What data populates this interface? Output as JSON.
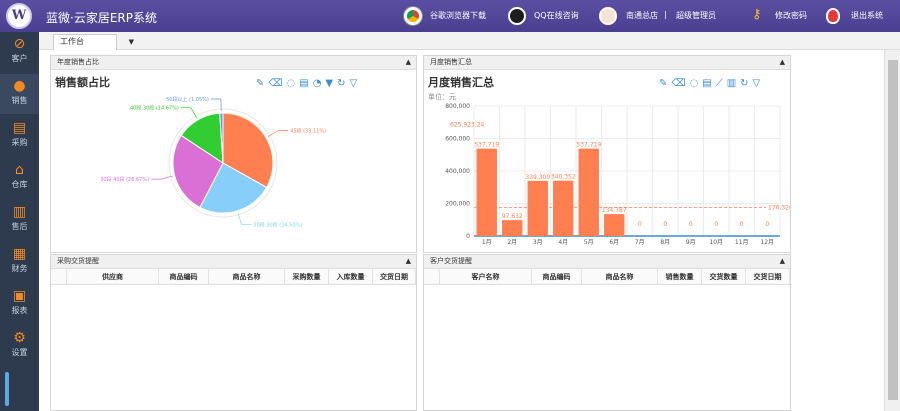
{
  "app": {
    "title": "蓝微·云家居ERP系统",
    "logo_text": "W"
  },
  "topbar": {
    "chrome_download": "谷歌浏览器下载",
    "qq_online": "QQ在线咨询",
    "store": "南通总店",
    "separator": "|",
    "role": "超级管理员",
    "change_password": "修改密码",
    "logout": "退出系统"
  },
  "sidebar": {
    "items": [
      {
        "label": "客户",
        "icon": "compass-icon"
      },
      {
        "label": "销售",
        "icon": "person-icon"
      },
      {
        "label": "采购",
        "icon": "cart-icon"
      },
      {
        "label": "仓库",
        "icon": "home-icon"
      },
      {
        "label": "售后",
        "icon": "chart-icon"
      },
      {
        "label": "财务",
        "icon": "grid-icon"
      },
      {
        "label": "报表",
        "icon": "report-icon"
      },
      {
        "label": "设置",
        "icon": "settings-icon"
      }
    ]
  },
  "tabs": {
    "active": "工作台",
    "caret": "▼"
  },
  "panels": {
    "annual": {
      "header": "年度销售占比",
      "chart_title": "销售额占比"
    },
    "monthly": {
      "header": "月度销售汇总",
      "chart_title": "月度销售汇总",
      "unit": "单位：元"
    },
    "purchase": {
      "header": "采购交货提醒",
      "columns": [
        "供应商",
        "商品编码",
        "商品名称",
        "采购数量",
        "入库数量",
        "交货日期"
      ]
    },
    "customer": {
      "header": "客户交货提醒",
      "columns": [
        "客户名称",
        "商品编码",
        "商品名称",
        "销售数量",
        "交货数量",
        "交货日期"
      ]
    }
  },
  "chart_data": [
    {
      "type": "pie",
      "title": "销售额占比",
      "slices": [
        {
          "label": "45段 (33.11%)",
          "value": 33.11,
          "color": "#ff7f50"
        },
        {
          "label": "30段 30段 (24.50%)",
          "value": 24.5,
          "color": "#87cefa"
        },
        {
          "label": "30段 40段 (26.67%)",
          "value": 26.67,
          "color": "#da70d6"
        },
        {
          "label": "40段 30段 (14.67%)",
          "value": 14.67,
          "color": "#32cd32"
        },
        {
          "label": "50段以上 (1.05%)",
          "value": 1.05,
          "color": "#6495ed"
        }
      ]
    },
    {
      "type": "bar",
      "title": "月度销售汇总",
      "categories": [
        "1月",
        "2月",
        "3月",
        "4月",
        "5月",
        "6月",
        "7月",
        "8月",
        "9月",
        "10月",
        "11月",
        "12月"
      ],
      "values": [
        537719,
        97632,
        339300,
        340352,
        537719,
        134787,
        0,
        0,
        0,
        0,
        0,
        0
      ],
      "data_labels": [
        "537,719",
        "97,632",
        "339,300",
        "340,352",
        "537,719",
        "134,787",
        "0",
        "0",
        "0",
        "0",
        "0",
        "0"
      ],
      "max_label": "625,923.24",
      "average_label": "176,326.27",
      "average": 176326.27,
      "yticks": [
        "0",
        "200,000",
        "400,000",
        "600,000",
        "800,000"
      ],
      "ylim": [
        0,
        800000
      ],
      "bar_color": "#ff7f50",
      "average_color": "#ff7f50"
    }
  ]
}
